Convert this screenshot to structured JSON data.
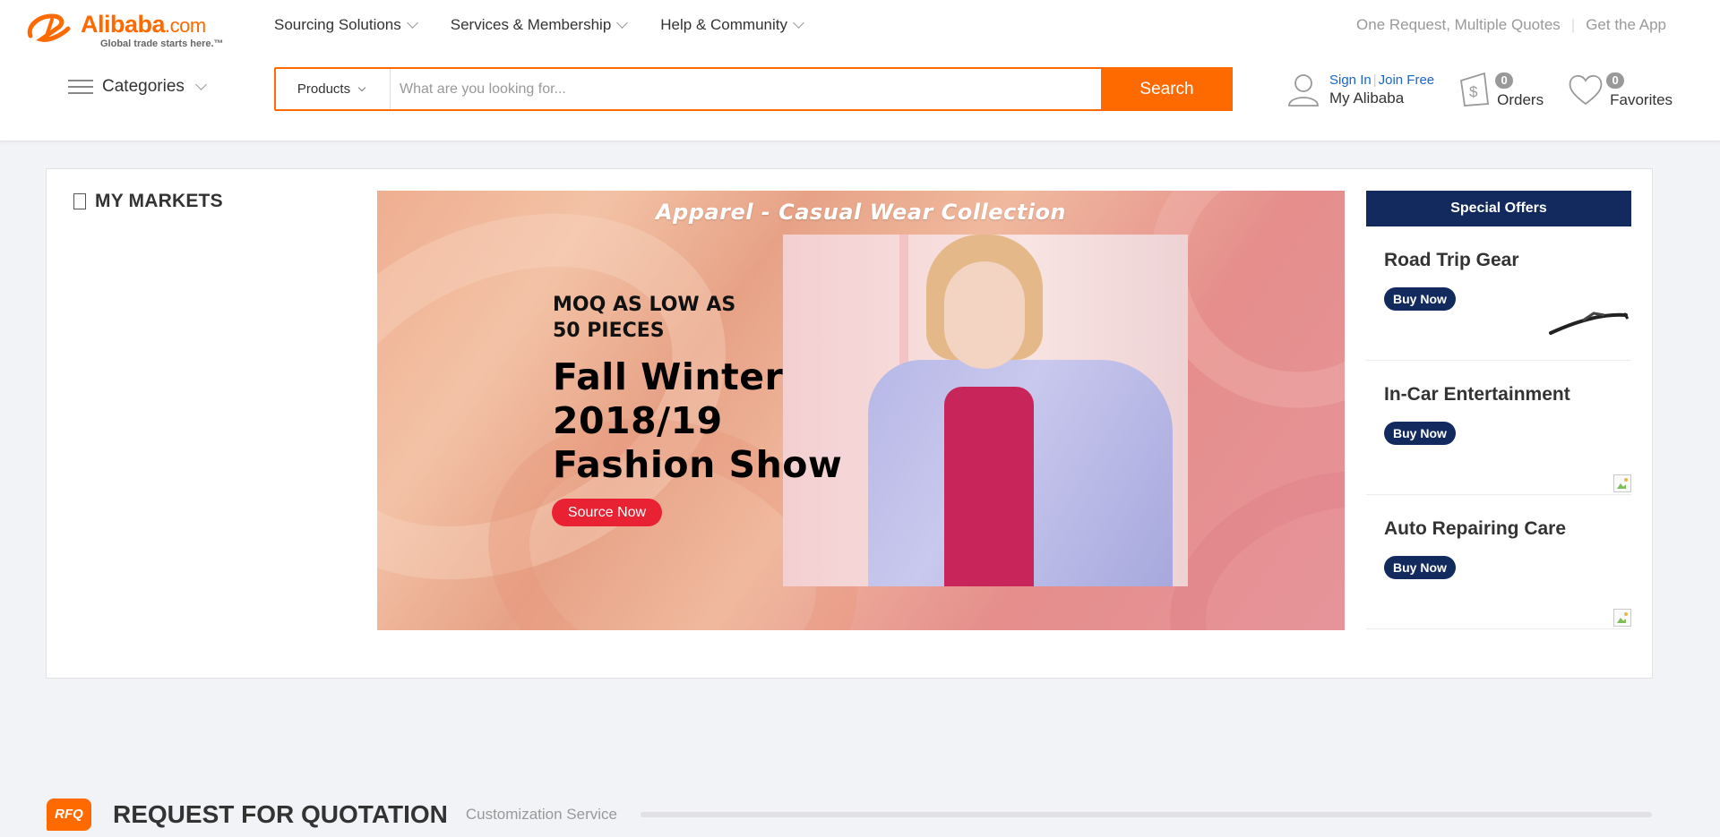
{
  "header": {
    "logo": {
      "brand": "Alibaba",
      "suffix": ".com",
      "tagline": "Global trade starts here.™"
    },
    "top_nav": [
      {
        "label": "Sourcing Solutions"
      },
      {
        "label": "Services & Membership"
      },
      {
        "label": "Help & Community"
      }
    ],
    "top_right": {
      "request_link": "One Request, Multiple Quotes",
      "app_link": "Get the App"
    },
    "categories_label": "Categories",
    "search": {
      "type_selected": "Products",
      "placeholder": "What are you looking for...",
      "value": "",
      "button_label": "Search"
    },
    "account": {
      "sign_in": "Sign In",
      "join": "Join Free",
      "label": "My Alibaba"
    },
    "orders": {
      "count": "0",
      "label": "Orders"
    },
    "favorites": {
      "count": "0",
      "label": "Favorites"
    }
  },
  "main": {
    "markets_title": "MY MARKETS",
    "banner": {
      "title": "Apparel - Casual Wear Collection",
      "moq": "MOQ AS LOW AS\n50 PIECES",
      "headline": "Fall Winter\n2018/19\nFashion Show",
      "button": "Source Now"
    },
    "special_offers": {
      "heading": "Special Offers",
      "items": [
        {
          "title": "Road Trip Gear",
          "button": "Buy Now"
        },
        {
          "title": "In-Car Entertainment",
          "button": "Buy Now"
        },
        {
          "title": "Auto Repairing Care",
          "button": "Buy Now"
        }
      ]
    }
  },
  "rfq": {
    "badge": "RFQ",
    "title": "REQUEST FOR QUOTATION",
    "subtitle": "Customization Service"
  },
  "colors": {
    "accent": "#ff6a00",
    "navy": "#132a5e",
    "red": "#e82233",
    "link": "#1a66cc"
  }
}
